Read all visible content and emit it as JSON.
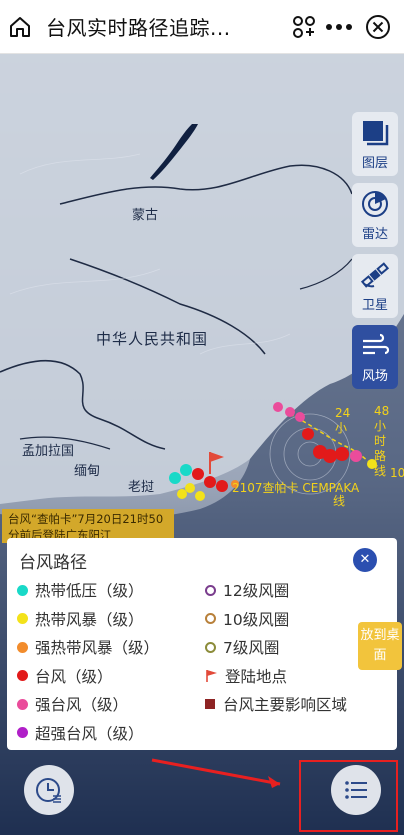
{
  "app": {
    "title": "台风实时路径追踪..."
  },
  "map": {
    "labels": {
      "mongolia": "蒙古",
      "china": "中华人民共和国",
      "bangladesh": "孟加拉国",
      "myanmar": "缅甸",
      "laos": "老挝"
    },
    "typhoon_label": "2107查帕卡 CEMPAKA",
    "forecast_24": "24小",
    "forecast_48": "48小时路线",
    "forecast_72": "10",
    "forecast_line": "线",
    "landfall_banner": "台风“查帕卡”7月20日21时50分前后登陆广东阳江"
  },
  "tools": [
    {
      "label": "图层",
      "icon": "layers-icon"
    },
    {
      "label": "雷达",
      "icon": "radar-icon"
    },
    {
      "label": "卫星",
      "icon": "satellite-icon"
    },
    {
      "label": "风场",
      "icon": "wind-icon"
    }
  ],
  "legend": {
    "title": "台风路径",
    "left": [
      {
        "label": "热带低压（级）",
        "color": "#19d9c8"
      },
      {
        "label": "热带风暴（级）",
        "color": "#f3e21a"
      },
      {
        "label": "强热带风暴（级）",
        "color": "#f28c2c"
      },
      {
        "label": "台风（级）",
        "color": "#e21a1a"
      },
      {
        "label": "强台风（级）",
        "color": "#ea4c9b"
      },
      {
        "label": "超强台风（级）",
        "color": "#b01fc8"
      }
    ],
    "right": [
      {
        "label": "12级风圈",
        "color": "#7a3d8d"
      },
      {
        "label": "10级风圈",
        "color": "#b8803a"
      },
      {
        "label": "7级风圈",
        "color": "#8c8c3a"
      },
      {
        "label": "登陆地点",
        "color": "#e24a3a"
      },
      {
        "label": "台风主要影响区域",
        "color": "#8e2424"
      }
    ]
  },
  "desk_button": "放到桌面"
}
